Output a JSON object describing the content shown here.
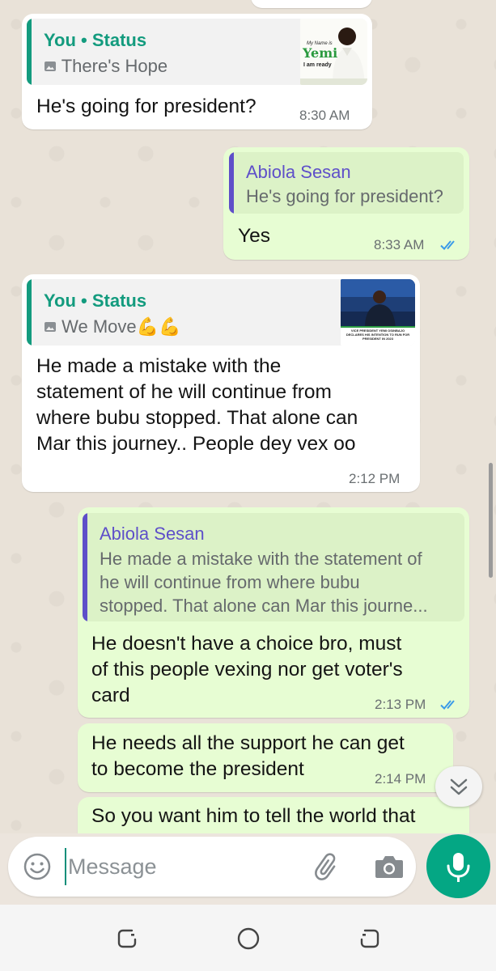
{
  "messages": [
    {
      "quote_author": "You",
      "quote_separator": "•",
      "quote_context": "Status",
      "quote_text": "There's Hope",
      "thumb_text": {
        "line1": "My Name is",
        "line2": "Yemi",
        "line3": "I am ready"
      },
      "text": "He's going for president?",
      "time": "8:30 AM"
    },
    {
      "quote_author": "Abiola Sesan",
      "quote_text": "He's going for president?",
      "text": "Yes",
      "time": "8:33 AM"
    },
    {
      "quote_author": "You",
      "quote_separator": "•",
      "quote_context": "Status",
      "quote_text": "We Move💪💪",
      "thumb_caption": "VICE PRESIDENT YEMI OSINBAJO DECLARES HIS INTENTION TO RUN FOR PRESIDENT IN 2023",
      "text_lines": [
        "He made a mistake with the",
        "statement of he will continue from",
        "where bubu stopped. That alone can",
        "Mar this journey.. People dey vex oo"
      ],
      "time": "2:12 PM"
    },
    {
      "quote_author": "Abiola Sesan",
      "quote_lines": [
        "He made a mistake with the statement of",
        "he will continue from where bubu",
        "stopped. That alone can Mar this journe..."
      ],
      "text_lines": [
        "He doesn't have a choice bro, must",
        "of this people vexing nor get voter's",
        "card"
      ],
      "time": "2:13 PM"
    },
    {
      "text_lines": [
        "He needs all the support he can get",
        "to become the president"
      ],
      "time": "2:14 PM"
    },
    {
      "text_lines": [
        "So you want him to tell the world that"
      ]
    }
  ],
  "input": {
    "placeholder": "Message"
  },
  "icons": {
    "emoji": "emoji-icon",
    "attach": "paperclip-icon",
    "camera": "camera-icon",
    "mic": "microphone-icon",
    "scroll_down": "double-chevron-down-icon",
    "status_image": "image-icon",
    "read_receipt": "double-check-icon",
    "nav_recent": "recent-apps-icon",
    "nav_home": "home-icon",
    "nav_back": "back-icon"
  },
  "colors": {
    "chat_background": "#e9e2d8",
    "incoming_bubble": "#ffffff",
    "outgoing_bubble": "#e7fdd3",
    "status_quote_accent": "#139b7e",
    "reply_quote_accent": "#5e4fc9",
    "read_tick_blue": "#3a9be8",
    "mic_button_green": "#04a784"
  }
}
